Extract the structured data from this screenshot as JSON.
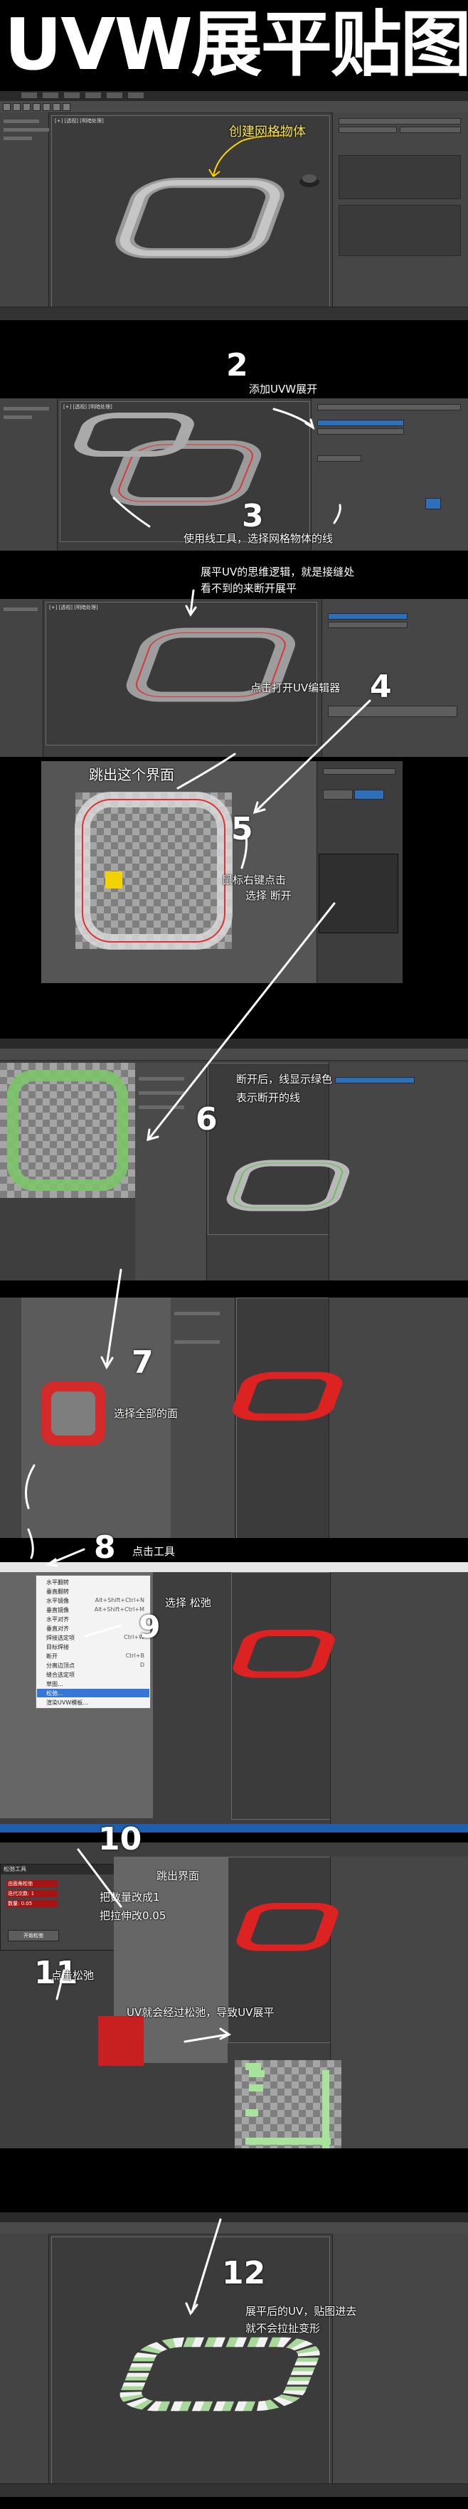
{
  "title": "UVW展平贴图",
  "app": {
    "viewport_label": "[+] [透视] [明暗处理]"
  },
  "steps": {
    "s1": "创建网格物体",
    "n2": "2",
    "s2": "添加UVW展开",
    "n3": "3",
    "s3": "使用线工具，选择网格物体的线",
    "note_line1": "展平UV的思维逻辑，就是接缝处",
    "note_line2": "看不到的来断开展平",
    "n4": "4",
    "s4": "点击打开UV编辑器",
    "s5_title": "跳出这个界面",
    "n5": "5",
    "s5_line1": "鼠标右键点击",
    "s5_line2": "选择  断开",
    "n6": "6",
    "s6_line1": "断开后，线显示绿色",
    "s6_line2": "表示断开的线",
    "n7": "7",
    "s7": "选择全部的面",
    "n8": "8",
    "s8": "点击工具",
    "n9": "9",
    "s9": "选择 松弛",
    "n10": "10",
    "s10_a": "跳出界面",
    "s10_b": "把数量改成1",
    "s10_c": "把拉伸改0.05",
    "n11": "11",
    "s11": "点击松弛",
    "s11_b": "UV就会经过松弛，导致UV展平",
    "n12": "12",
    "s12_line1": "展平后的UV，贴图进去",
    "s12_line2": "就不会拉扯变形"
  },
  "menu9": {
    "items": [
      {
        "label": "水平翻转",
        "shortcut": ""
      },
      {
        "label": "垂直翻转",
        "shortcut": ""
      },
      {
        "label": "水平镜像",
        "shortcut": "Alt+Shift+Ctrl+N"
      },
      {
        "label": "垂直镜像",
        "shortcut": "Alt+Shift+Ctrl+M"
      },
      {
        "label": "水平对齐",
        "shortcut": ""
      },
      {
        "label": "垂直对齐",
        "shortcut": ""
      },
      {
        "label": "焊接选定项",
        "shortcut": "Ctrl+W"
      },
      {
        "label": "目标焊接",
        "shortcut": ""
      },
      {
        "label": "断开",
        "shortcut": "Ctrl+B"
      },
      {
        "label": "分离边顶点",
        "shortcut": "D"
      },
      {
        "label": "缝合选定项",
        "shortcut": ""
      },
      {
        "label": "草图...",
        "shortcut": ""
      },
      {
        "label": "松弛...",
        "shortcut": ""
      },
      {
        "label": "渲染UVW模板...",
        "shortcut": ""
      }
    ]
  },
  "dialog10": {
    "title": "松弛工具",
    "rows": [
      "由面角松弛",
      "迭代次数: 1",
      "数量: 0.05"
    ],
    "button": "开始松弛"
  }
}
